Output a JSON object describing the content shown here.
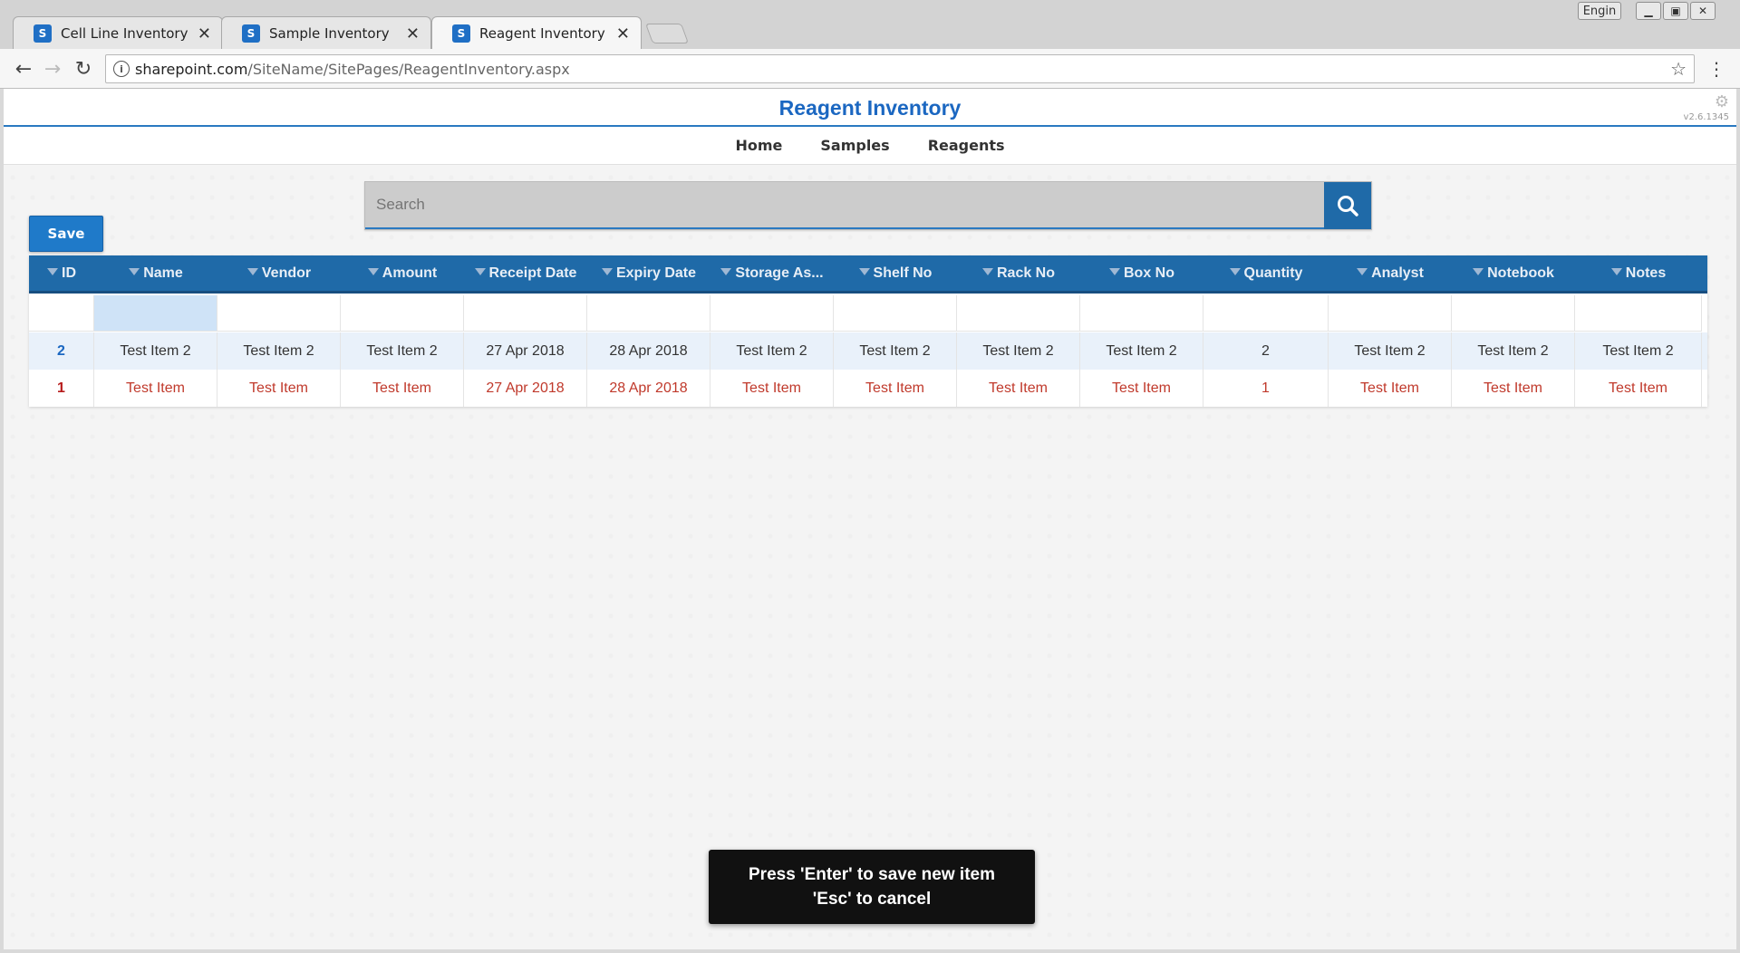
{
  "browser": {
    "tabs": [
      {
        "label": "Cell Line Inventory"
      },
      {
        "label": "Sample Inventory"
      },
      {
        "label": "Reagent Inventory"
      }
    ],
    "user": "Engin",
    "url_domain": "sharepoint.com",
    "url_path": "/SiteName/SitePages/ReagentInventory.aspx"
  },
  "header": {
    "title": "Reagent Inventory",
    "version": "v2.6.1345"
  },
  "nav": {
    "items": [
      {
        "label": "Home"
      },
      {
        "label": "Samples"
      },
      {
        "label": "Reagents"
      }
    ]
  },
  "search": {
    "placeholder": "Search"
  },
  "toolbar": {
    "save_label": "Save"
  },
  "table": {
    "columns": [
      "ID",
      "Name",
      "Vendor",
      "Amount",
      "Receipt Date",
      "Expiry Date",
      "Storage As...",
      "Shelf No",
      "Rack No",
      "Box No",
      "Quantity",
      "Analyst",
      "Notebook",
      "Notes"
    ],
    "rows": [
      [
        "2",
        "Test Item 2",
        "Test Item 2",
        "Test Item 2",
        "27 Apr 2018",
        "28 Apr 2018",
        "Test Item 2",
        "Test Item 2",
        "Test Item 2",
        "Test Item 2",
        "2",
        "Test Item 2",
        "Test Item 2",
        "Test Item 2"
      ],
      [
        "1",
        "Test Item",
        "Test Item",
        "Test Item",
        "27 Apr 2018",
        "28 Apr 2018",
        "Test Item",
        "Test Item",
        "Test Item",
        "Test Item",
        "1",
        "Test Item",
        "Test Item",
        "Test Item"
      ]
    ]
  },
  "toast": {
    "line1": "Press 'Enter' to save new item",
    "line2": "'Esc' to cancel"
  },
  "colors": {
    "accent": "#1f6aa8",
    "title": "#1b67c1",
    "row_old": "#c0392b"
  }
}
